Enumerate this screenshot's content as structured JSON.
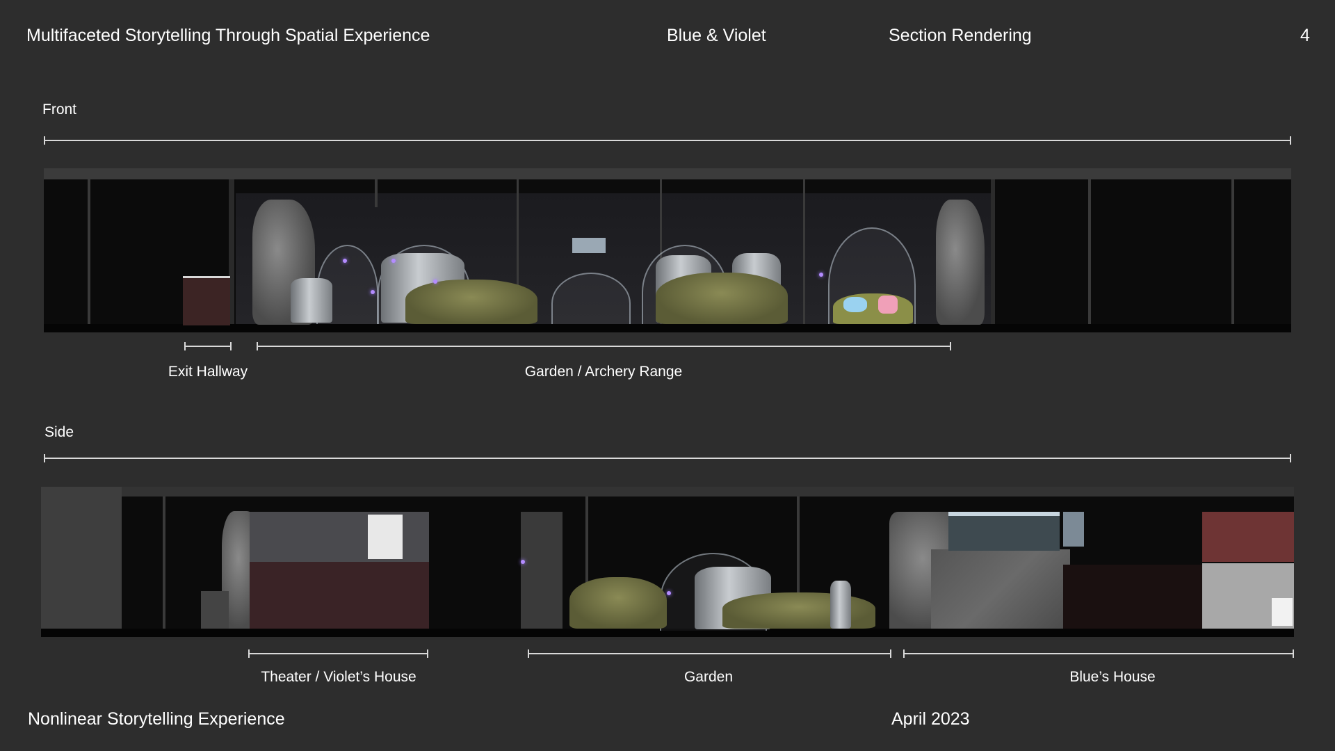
{
  "header": {
    "title": "Multifaceted Storytelling Through Spatial Experience",
    "project": "Blue & Violet",
    "subject": "Section Rendering",
    "page_number": "4"
  },
  "sections": {
    "front": {
      "label": "Front",
      "zones": [
        "Exit Hallway",
        "Garden / Archery Range"
      ]
    },
    "side": {
      "label": "Side",
      "zones": [
        "Theater / Violet’s House",
        "Garden",
        "Blue’s House"
      ]
    }
  },
  "footer": {
    "left": "Nonlinear Storytelling Experience",
    "date": "April 2023"
  },
  "colors": {
    "background": "#2d2d2d",
    "text": "#ffffff",
    "rule": "#d9d9d9"
  }
}
